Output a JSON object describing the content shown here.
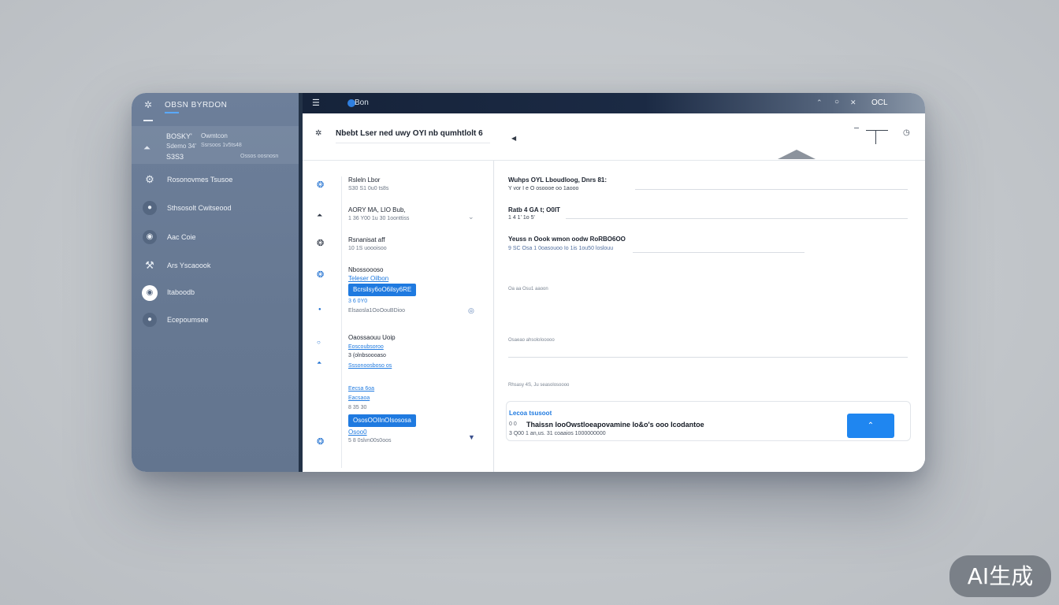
{
  "sidebar": {
    "title": "OBSN BYRDON",
    "summary": {
      "line1": "BOSKY'",
      "line1b": "Owmtcon",
      "line2": "Sdemo 34'",
      "line2b": "Ssrsoos 1v5ts48",
      "line3": "S3S3",
      "line3b": "Ossos oosnosn"
    },
    "items": [
      {
        "label": "Rosonovmes Tsusoe",
        "icon": "settings-icon"
      },
      {
        "label": "Sthsosolt Cwitseood",
        "icon": "circle-icon"
      },
      {
        "label": "Aac Coie",
        "icon": "circle-icon"
      },
      {
        "label": "Ars Yscaoook",
        "icon": "tools-icon"
      },
      {
        "label": "Itaboodb",
        "icon": "eye-icon"
      },
      {
        "label": "Ecepoumsee",
        "icon": "circle-icon"
      }
    ]
  },
  "topbar": {
    "brand": "Bon",
    "icons": [
      "up-icon",
      "circle-icon",
      "close-icon"
    ],
    "label": "OCL"
  },
  "toolbar": {
    "title": "Nbebt Lser ned uwy OYI nb qumhtlolt 6"
  },
  "list": {
    "items": [
      {
        "title": "Rsleln Lbor",
        "sub": "S30 S1 0u0 ts8s"
      },
      {
        "title": "AORY MA, LIO Bub,",
        "sub": "1 36 Y00 1u 30 1oonttiss"
      },
      {
        "title": "Rsnanisat aff",
        "sub": "10 1S uoooisoo"
      },
      {
        "title": "Nbossoooso",
        "link": "Teleser Oilbon",
        "chip": "Bcrsilsy6oO6ilsy6RE",
        "sub": "3 6 0Y0",
        "sub2": "Elsaosla1OoOouBDioo"
      },
      {
        "title": "Oaossaouu Uoip",
        "link": "Eoscoubsoroo",
        "sub": "3 (olnbsoooaso",
        "link2": "Sssonoosboso os"
      },
      {
        "link": "Eecsa 6oa",
        "link2": "Eacsaoa",
        "sub": "8 35 30",
        "chip": "OsosOOIInOIsososa",
        "link3": "Osoo0",
        "sub2": "5 8 0slvn00s0oos"
      }
    ]
  },
  "detail": {
    "rows": [
      {
        "title": "Wuhps OYL Lboudloog, Dnrs 81:",
        "sub": "Y vor I e O osoooe oo 1aooo"
      },
      {
        "title": "Ratb 4 GA t; O0IT",
        "sub": "1 4 1' 1o 5'"
      },
      {
        "title": "Yeuss n Oook wmon oodw RoRBO6OO",
        "sub": "9 SC Osa 1 0oasouoo Io 1is 1ou50 loslouu"
      }
    ],
    "tiny1": "Oa aa Osu1 aaoon",
    "tiny2": "Osaeao ahsoloIooooo",
    "tiny3": "Rhsasy 4S, Ju seasolosoooo",
    "card": {
      "label": "Lecoa tsusoot",
      "pre": "0 0",
      "text": "Thaissn looOwstloeapovamine Io&o's ooo Icodantoe",
      "sub": "3 Q00 1 an,us. 31 coaaios 1000000000",
      "button_icon": "up-icon"
    }
  },
  "badge": "AI生成"
}
